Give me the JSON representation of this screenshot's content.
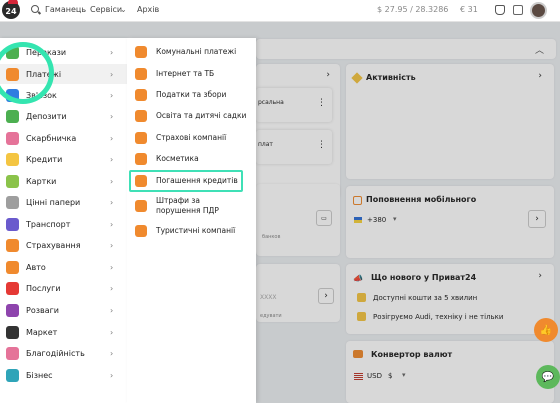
{
  "topbar": {
    "logo_text": "24",
    "nav": [
      "Гаманець",
      "Сервіси",
      "Архів"
    ],
    "rate1": "$  27.95  /  28.3286",
    "rate2": "€  31"
  },
  "main_menu": [
    {
      "label": "Перекази",
      "icon_color": "#4caf50"
    },
    {
      "label": "Платежі",
      "icon_color": "#f08a2e",
      "active": true
    },
    {
      "label": "Зв'язок",
      "icon_color": "#2f7de1"
    },
    {
      "label": "Депозити",
      "icon_color": "#4caf50"
    },
    {
      "label": "Скарбничка",
      "icon_color": "#e57399"
    },
    {
      "label": "Кредити",
      "icon_color": "#f4c542"
    },
    {
      "label": "Картки",
      "icon_color": "#8bc34a"
    },
    {
      "label": "Цінні папери",
      "icon_color": "#9e9e9e"
    },
    {
      "label": "Транспорт",
      "icon_color": "#6a5acd"
    },
    {
      "label": "Страхування",
      "icon_color": "#f08a2e"
    },
    {
      "label": "Авто",
      "icon_color": "#f08a2e"
    },
    {
      "label": "Послуги",
      "icon_color": "#e53935"
    },
    {
      "label": "Розваги",
      "icon_color": "#8e44ad"
    },
    {
      "label": "Маркет",
      "icon_color": "#333333"
    },
    {
      "label": "Благодійність",
      "icon_color": "#e57399"
    },
    {
      "label": "Бізнес",
      "icon_color": "#2fa4b8"
    }
  ],
  "submenu": [
    {
      "label": "Комунальні платежі"
    },
    {
      "label": "Інтернет та ТБ"
    },
    {
      "label": "Податки та збори"
    },
    {
      "label": "Освіта та дитячі садки"
    },
    {
      "label": "Страхові компанії"
    },
    {
      "label": "Косметика"
    },
    {
      "label": "Погашення кредитів",
      "highlighted": true
    },
    {
      "label": "Штрафи за порушення ПДР"
    },
    {
      "label": "Туристичні компанії"
    }
  ],
  "right": {
    "activity_title": "Активність",
    "mobile_title": "Поповнення мобільного",
    "phone_prefix": "+380",
    "news_title": "Що нового у Приват24",
    "news_items": [
      "Доступні кошти за 5 хвилин",
      "Розігруємо Audi, техніку і не тільки"
    ],
    "converter_title": "Конвертор валют",
    "currency": "USD",
    "currency_symbol": "$"
  },
  "middle_fragments": {
    "frag1": "рсальна",
    "frag2": "плат",
    "frag3": "банков",
    "frag4": "XXXX",
    "frag5": "едувати"
  }
}
